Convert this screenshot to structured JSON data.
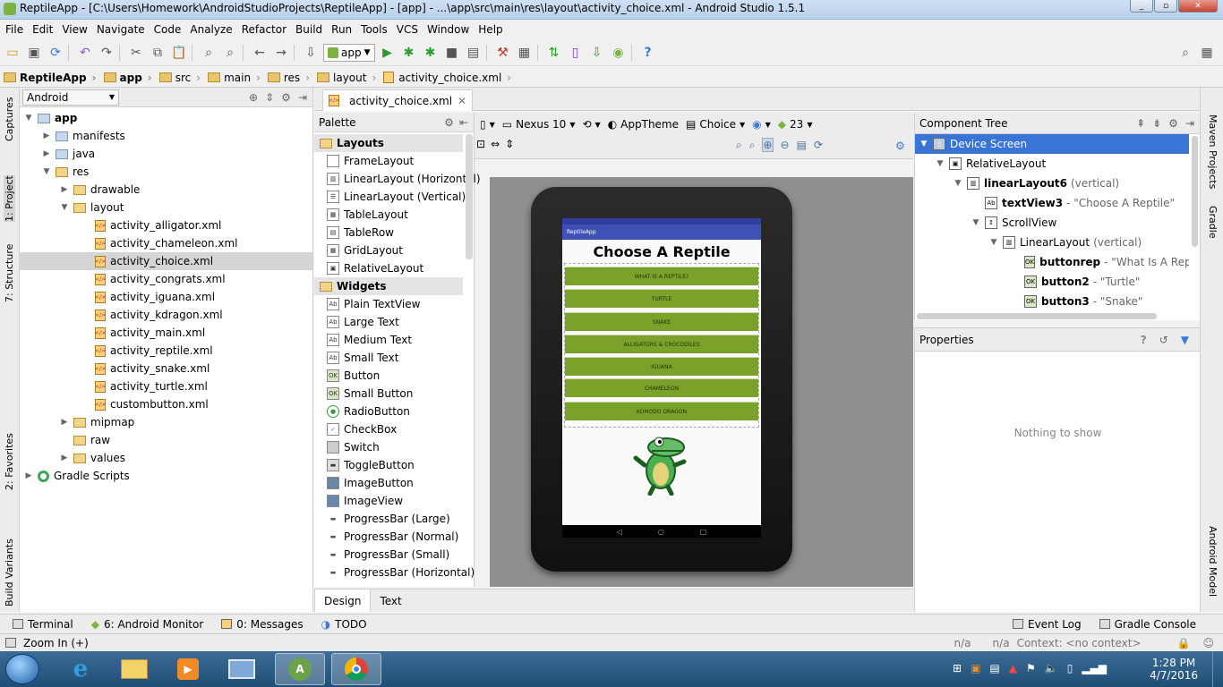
{
  "window": {
    "title": "ReptileApp - [C:\\Users\\Homework\\AndroidStudioProjects\\ReptileApp] - [app] - ...\\app\\src\\main\\res\\layout\\activity_choice.xml - Android Studio 1.5.1"
  },
  "menu": [
    "File",
    "Edit",
    "View",
    "Navigate",
    "Code",
    "Analyze",
    "Refactor",
    "Build",
    "Run",
    "Tools",
    "VCS",
    "Window",
    "Help"
  ],
  "toolbar": {
    "run_config": "app"
  },
  "breadcrumbs": [
    "ReptileApp",
    "app",
    "src",
    "main",
    "res",
    "layout",
    "activity_choice.xml"
  ],
  "left_strip": {
    "captures": "Captures",
    "project": "1: Project",
    "structure": "7: Structure",
    "favorites": "2: Favorites",
    "build_variants": "Build Variants"
  },
  "right_strip": {
    "maven": "Maven Projects",
    "gradle": "Gradle",
    "android_model": "Android Model"
  },
  "project": {
    "view_mode": "Android",
    "tree": [
      {
        "label": "app",
        "bold": true
      },
      {
        "label": "manifests"
      },
      {
        "label": "java"
      },
      {
        "label": "res"
      },
      {
        "label": "drawable"
      },
      {
        "label": "layout"
      },
      {
        "label": "activity_alligator.xml"
      },
      {
        "label": "activity_chameleon.xml"
      },
      {
        "label": "activity_choice.xml"
      },
      {
        "label": "activity_congrats.xml"
      },
      {
        "label": "activity_iguana.xml"
      },
      {
        "label": "activity_kdragon.xml"
      },
      {
        "label": "activity_main.xml"
      },
      {
        "label": "activity_reptile.xml"
      },
      {
        "label": "activity_snake.xml"
      },
      {
        "label": "activity_turtle.xml"
      },
      {
        "label": "custombutton.xml"
      },
      {
        "label": "mipmap"
      },
      {
        "label": "raw"
      },
      {
        "label": "values"
      },
      {
        "label": "Gradle Scripts"
      }
    ]
  },
  "editor": {
    "tab": "activity_choice.xml"
  },
  "palette": {
    "title": "Palette",
    "groups": [
      {
        "name": "Layouts",
        "items": [
          "FrameLayout",
          "LinearLayout (Horizontal)",
          "LinearLayout (Vertical)",
          "TableLayout",
          "TableRow",
          "GridLayout",
          "RelativeLayout"
        ]
      },
      {
        "name": "Widgets",
        "items": [
          "Plain TextView",
          "Large Text",
          "Medium Text",
          "Small Text",
          "Button",
          "Small Button",
          "RadioButton",
          "CheckBox",
          "Switch",
          "ToggleButton",
          "ImageButton",
          "ImageView",
          "ProgressBar (Large)",
          "ProgressBar (Normal)",
          "ProgressBar (Small)",
          "ProgressBar (Horizontal)"
        ]
      }
    ]
  },
  "design_toolbar": {
    "device": "Nexus 10",
    "theme": "AppTheme",
    "activity": "Choice",
    "api": "23"
  },
  "preview": {
    "app_name": "ReptileApp",
    "heading": "Choose A Reptile",
    "buttons": [
      "WHAT IS A REPTILE?",
      "TURTLE",
      "SNAKE",
      "ALLIGATORS & CROCODILES",
      "IGUANA",
      "CHAMELEON",
      "KOMODO DRAGON"
    ]
  },
  "bottom_tabs": [
    "Design",
    "Text"
  ],
  "component_tree": {
    "title": "Component Tree",
    "items": [
      {
        "name": "Device Screen",
        "detail": ""
      },
      {
        "name": "RelativeLayout",
        "detail": ""
      },
      {
        "name": "linearLayout6",
        "detail": "(vertical)"
      },
      {
        "name": "textView3",
        "detail": "- \"Choose A Reptile\""
      },
      {
        "name": "ScrollView",
        "detail": ""
      },
      {
        "name": "LinearLayout",
        "detail": "(vertical)"
      },
      {
        "name": "buttonrep",
        "detail": "- \"What Is A Reptile"
      },
      {
        "name": "button2",
        "detail": "- \"Turtle\""
      },
      {
        "name": "button3",
        "detail": "- \"Snake\""
      }
    ]
  },
  "properties": {
    "title": "Properties",
    "empty": "Nothing to show"
  },
  "tool_windows": {
    "terminal": "Terminal",
    "android_monitor": "6: Android Monitor",
    "messages": "0: Messages",
    "todo": "TODO",
    "event_log": "Event Log",
    "gradle_console": "Gradle Console"
  },
  "status": {
    "message": "Zoom In (+)",
    "na1": "n/a",
    "na2": "n/a",
    "context": "Context: <no context>"
  },
  "taskbar": {
    "time": "1:28 PM",
    "date": "4/7/2016"
  },
  "colors": {
    "selection": "#3875d7",
    "button_green": "#7aa12a",
    "appbar": "#3f51b5"
  }
}
